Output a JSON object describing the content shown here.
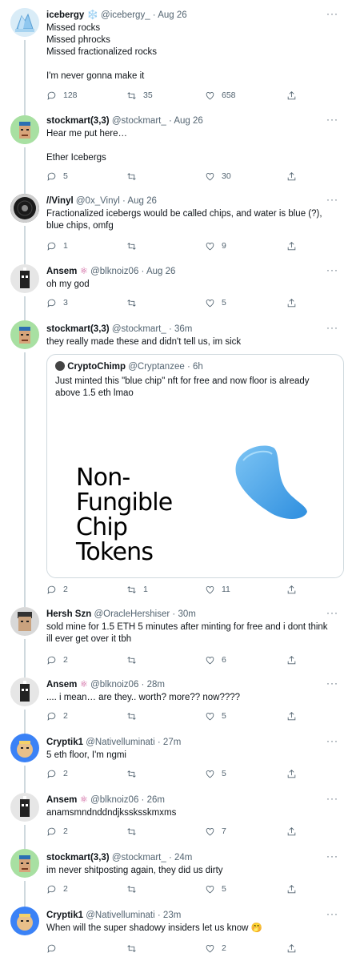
{
  "tweets": [
    {
      "name": "icebergy",
      "emoji": "❄️",
      "handle": "@icebergy_",
      "time": "Aug 26",
      "lines": [
        "Missed rocks",
        "Missed phrocks",
        "Missed fractionalized rocks",
        "",
        "I'm never gonna make it"
      ],
      "reply": "128",
      "retweet": "35",
      "like": "658"
    },
    {
      "name": "stockmart(3,3)",
      "handle": "@stockmart_",
      "time": "Aug 26",
      "lines": [
        "Hear me put here…",
        "",
        "Ether Icebergs"
      ],
      "reply": "5",
      "retweet": "",
      "like": "30"
    },
    {
      "name": "//Vinyl",
      "handle": "@0x_Vinyl",
      "time": "Aug 26",
      "lines": [
        "Fractionalized icebergs would be called chips, and water is blue (?), blue chips, omfg"
      ],
      "reply": "1",
      "retweet": "",
      "like": "9"
    },
    {
      "name": "Ansem",
      "handle": "@blknoiz06",
      "time": "Aug 26",
      "lines": [
        "oh my god"
      ],
      "reply": "3",
      "retweet": "",
      "like": "5"
    },
    {
      "name": "stockmart(3,3)",
      "handle": "@stockmart_",
      "time": "36m",
      "lines": [
        "they really made these and didn't tell us, im sick"
      ],
      "quote": {
        "name": "CryptoChimp",
        "handle": "@Cryptanzee",
        "time": "6h",
        "text": "Just minted this \"blue chip\" nft for free and now floor is already above 1.5 eth lmao",
        "image_lines": [
          "Non-",
          "Fungible",
          "Chip",
          "Tokens"
        ]
      },
      "reply": "2",
      "retweet": "1",
      "like": "11"
    },
    {
      "name": "Hersh Szn",
      "handle": "@OracleHershiser",
      "time": "30m",
      "lines": [
        "sold mine for 1.5 ETH 5 minutes after minting for free and i dont think ill ever get over it tbh"
      ],
      "reply": "2",
      "retweet": "",
      "like": "6"
    },
    {
      "name": "Ansem",
      "handle": "@blknoiz06",
      "time": "28m",
      "lines": [
        ".... i mean… are they.. worth? more??  now????"
      ],
      "reply": "2",
      "retweet": "",
      "like": "5"
    },
    {
      "name": "Cryptik1",
      "handle": "@Nativelluminati",
      "time": "27m",
      "lines": [
        "5 eth floor, I'm ngmi"
      ],
      "reply": "2",
      "retweet": "",
      "like": "5"
    },
    {
      "name": "Ansem",
      "handle": "@blknoiz06",
      "time": "26m",
      "lines": [
        "anamsmndnddndjkssksskmxms"
      ],
      "reply": "2",
      "retweet": "",
      "like": "7"
    },
    {
      "name": "stockmart(3,3)",
      "handle": "@stockmart_",
      "time": "24m",
      "lines": [
        "im never shitposting again, they did us dirty"
      ],
      "reply": "2",
      "retweet": "",
      "like": "5"
    },
    {
      "name": "Cryptik1",
      "handle": "@Nativelluminati",
      "time": "23m",
      "lines": [
        "When will the super shadowy insiders let us know 🤭"
      ],
      "reply": "",
      "retweet": "",
      "like": "2"
    }
  ],
  "colors": {
    "text": "#0f1419",
    "muted": "#536471",
    "border": "#cfd9de",
    "chip": "#4aa3e6"
  }
}
